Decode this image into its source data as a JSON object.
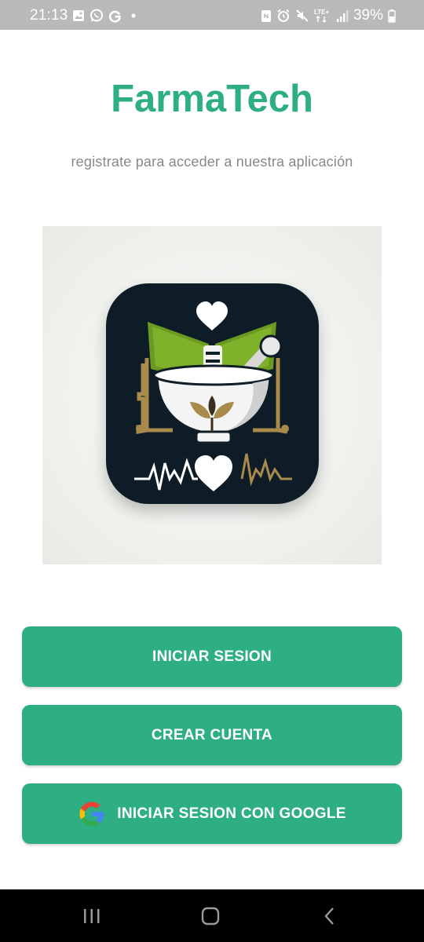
{
  "status_bar": {
    "time": "21:13",
    "battery": "39%",
    "left_icons": [
      "gallery-icon",
      "whatsapp-icon",
      "google-g-icon",
      "dot-icon"
    ],
    "right_icons": [
      "nfc-icon",
      "alarm-icon",
      "mute-icon",
      "lte-signal-icon",
      "signal-bars-icon",
      "battery-icon"
    ],
    "network_label": "LTE+"
  },
  "app": {
    "title": "FarmaTech",
    "subtitle": "registrate para acceder a nuestra aplicación"
  },
  "buttons": {
    "login": "INICIAR SESION",
    "create": "CREAR CUENTA",
    "google": "INICIAR SESION CON GOOGLE"
  },
  "colors": {
    "accent": "#2eaf83",
    "subtitle": "#888888",
    "logo_background": "#0f1d26",
    "logo_green": "#6b9a22",
    "logo_gold": "#a88a4b"
  },
  "nav_bar": {
    "icons": [
      "recents-icon",
      "home-icon",
      "back-icon"
    ]
  }
}
